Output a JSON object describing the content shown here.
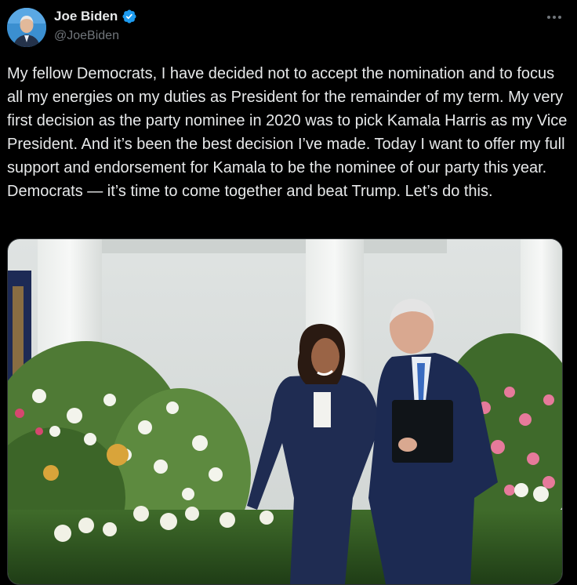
{
  "author": {
    "display_name": "Joe Biden",
    "handle": "@JoeBiden",
    "verified_icon": "verified-badge-icon",
    "avatar_icon": "avatar-photo"
  },
  "more_icon": "more-options-icon",
  "tweet": {
    "text": "My fellow Democrats, I have decided not to accept the nomination and to focus all my energies on my duties as President for the remainder of my term. My very first decision as the party nominee in 2020 was to pick Kamala Harris as my Vice President. And it’s been the best decision I’ve made. Today I want to offer my full support and endorsement for Kamala to be the nominee of our party this year. Democrats — it’s time to come together and beat Trump. Let’s do this."
  },
  "media": {
    "image_icon": "tweet-photo"
  },
  "colors": {
    "background": "#000000",
    "text": "#e7e9ea",
    "secondary": "#71767b",
    "verified": "#1d9bf0"
  }
}
